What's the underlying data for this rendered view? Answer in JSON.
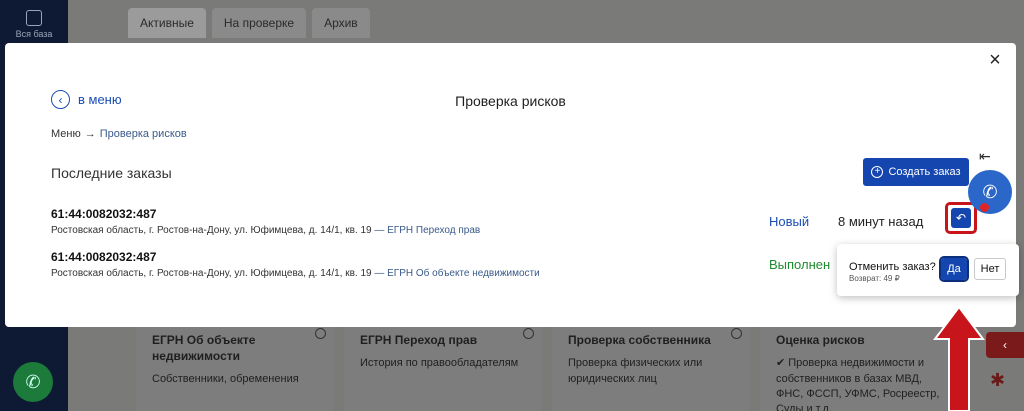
{
  "sidebar": {
    "all_base_label": "Вся база"
  },
  "background_tabs": [
    {
      "label": "Активные"
    },
    {
      "label": "На проверке"
    },
    {
      "label": "Архив"
    }
  ],
  "background_cards": [
    {
      "title": "ЕГРН Об объекте недвижимости",
      "desc": "Собственники, обременения"
    },
    {
      "title": "ЕГРН Переход прав",
      "desc": "История по правообладателям"
    },
    {
      "title": "Проверка собственника",
      "desc": "Проверка физических или юридических лиц"
    },
    {
      "title": "Оценка рисков",
      "desc": "✔ Проверка недвижимости и собственников в базах МВД, ФНС, ФССП, УФМС, Росреестр, Суды и т.д."
    }
  ],
  "modal": {
    "back_label": "в меню",
    "title": "Проверка рисков",
    "breadcrumb": {
      "root": "Меню",
      "sep": "→",
      "current": "Проверка рисков"
    },
    "section_title": "Последние заказы",
    "create_button": "Создать заказ",
    "orders": [
      {
        "number": "61:44:0082032:487",
        "address": "Ростовская область, г. Ростов-на-Дону, ул. Юфимцева, д. 14/1, кв. 19",
        "service": " — ЕГРН Переход прав",
        "status": "Новый",
        "time": "8 минут назад"
      },
      {
        "number": "61:44:0082032:487",
        "address": "Ростовская область, г. Ростов-на-Дону, ул. Юфимцева, д. 14/1, кв. 19",
        "service": " — ЕГРН Об объекте недвижимости",
        "status": "Выполнен",
        "time": ""
      }
    ]
  },
  "confirm": {
    "question": "Отменить заказ?",
    "refund": "Возврат: 49 ₽",
    "yes": "Да",
    "no": "Нет"
  },
  "colors": {
    "primary": "#1546b0",
    "status_new": "#1a4db3",
    "status_done": "#1f8a2e",
    "highlight": "#c8141b"
  }
}
